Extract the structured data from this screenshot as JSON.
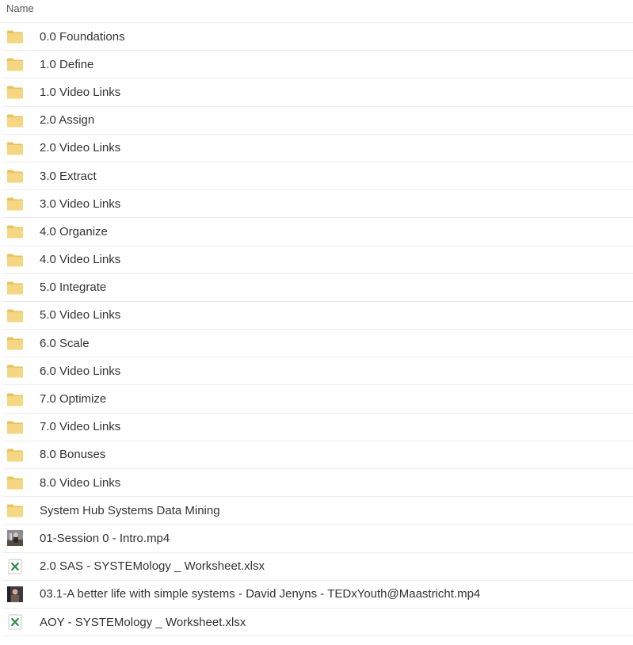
{
  "header": {
    "name_label": "Name"
  },
  "colors": {
    "folder": "#f5d682",
    "folder_dark": "#e8c25a",
    "excel_green": "#2e8b47",
    "row_border": "#ececec"
  },
  "files": [
    {
      "name": "0.0 Foundations",
      "type": "folder",
      "icon": "folder-icon"
    },
    {
      "name": "1.0 Define",
      "type": "folder",
      "icon": "folder-icon"
    },
    {
      "name": "1.0 Video Links",
      "type": "folder",
      "icon": "folder-icon"
    },
    {
      "name": "2.0 Assign",
      "type": "folder",
      "icon": "folder-icon"
    },
    {
      "name": "2.0 Video Links",
      "type": "folder",
      "icon": "folder-icon"
    },
    {
      "name": "3.0 Extract",
      "type": "folder",
      "icon": "folder-icon"
    },
    {
      "name": "3.0 Video Links",
      "type": "folder",
      "icon": "folder-icon"
    },
    {
      "name": "4.0 Organize",
      "type": "folder",
      "icon": "folder-icon"
    },
    {
      "name": "4.0 Video Links",
      "type": "folder",
      "icon": "folder-icon"
    },
    {
      "name": "5.0 Integrate",
      "type": "folder",
      "icon": "folder-icon"
    },
    {
      "name": "5.0 Video Links",
      "type": "folder",
      "icon": "folder-icon"
    },
    {
      "name": "6.0 Scale",
      "type": "folder",
      "icon": "folder-icon"
    },
    {
      "name": "6.0 Video Links",
      "type": "folder",
      "icon": "folder-icon"
    },
    {
      "name": "7.0 Optimize",
      "type": "folder",
      "icon": "folder-icon"
    },
    {
      "name": "7.0 Video Links",
      "type": "folder",
      "icon": "folder-icon"
    },
    {
      "name": "8.0 Bonuses",
      "type": "folder",
      "icon": "folder-icon"
    },
    {
      "name": "8.0 Video Links",
      "type": "folder",
      "icon": "folder-icon"
    },
    {
      "name": "System Hub Systems Data Mining",
      "type": "folder",
      "icon": "folder-icon"
    },
    {
      "name": "01-Session 0 - Intro.mp4",
      "type": "video",
      "icon": "video-thumbnail-icon"
    },
    {
      "name": "2.0 SAS - SYSTEMology _ Worksheet.xlsx",
      "type": "xlsx",
      "icon": "excel-icon"
    },
    {
      "name": "03.1-A better life with simple systems - David Jenyns - TEDxYouth@Maastricht.mp4",
      "type": "video",
      "icon": "video-thumbnail-icon"
    },
    {
      "name": "AOY - SYSTEMology _ Worksheet.xlsx",
      "type": "xlsx",
      "icon": "excel-icon"
    }
  ]
}
